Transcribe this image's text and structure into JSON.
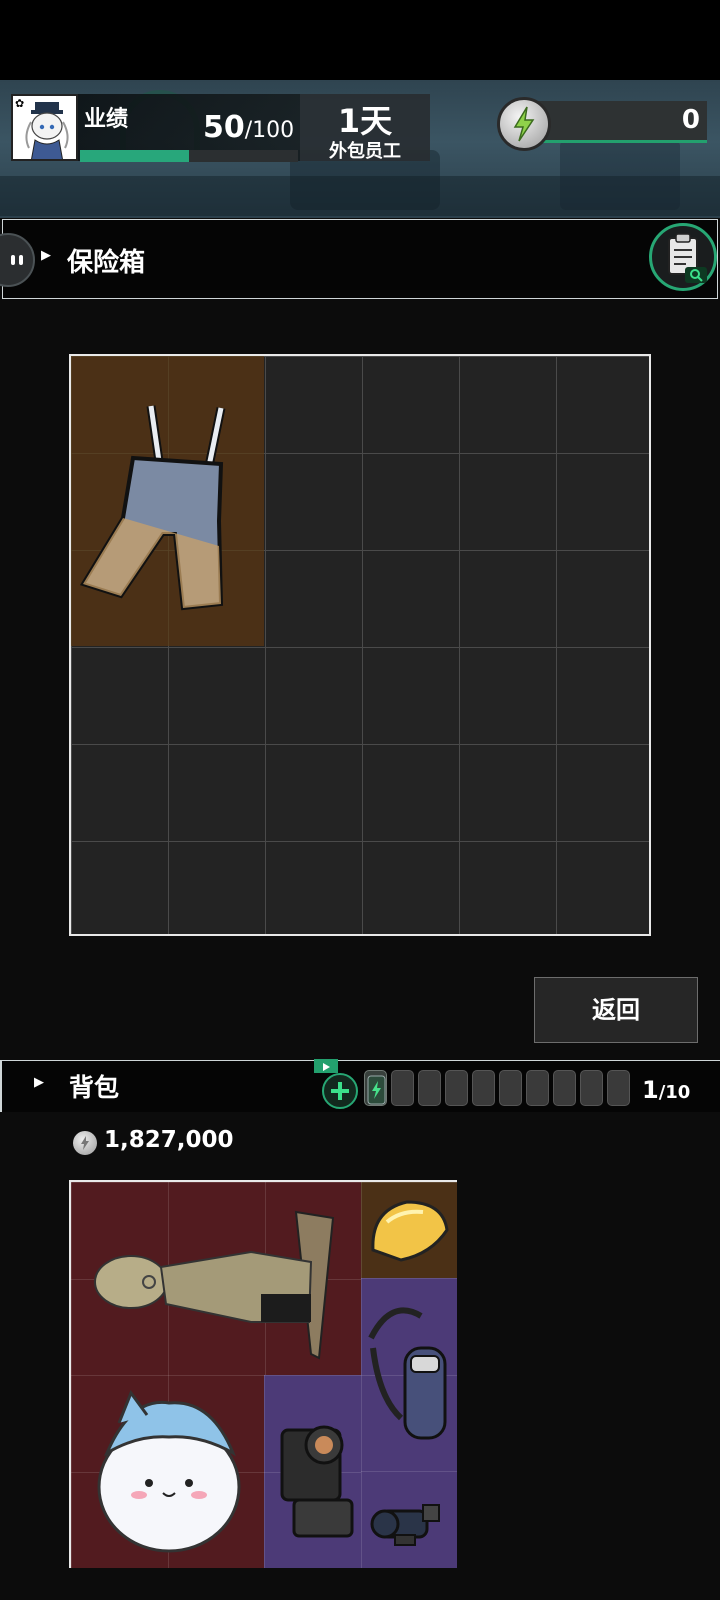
{
  "header": {
    "performance_label": "业绩",
    "performance_current": "50",
    "performance_max": "/100",
    "performance_progress": 0.5,
    "day_value": "1天",
    "day_label": "外包员工",
    "energy_value": "0"
  },
  "safe": {
    "title": "保险箱",
    "grid_cols": 6,
    "grid_rows": 6
  },
  "actions": {
    "back_label": "返回"
  },
  "backpack": {
    "title": "背包",
    "count_current": "1",
    "count_max": "/10",
    "money": "1,827,000"
  },
  "colors": {
    "accent_green": "#27a774",
    "slot_red": "#521b1f",
    "slot_brown": "#4b3016",
    "slot_purple": "#4c3a77"
  }
}
